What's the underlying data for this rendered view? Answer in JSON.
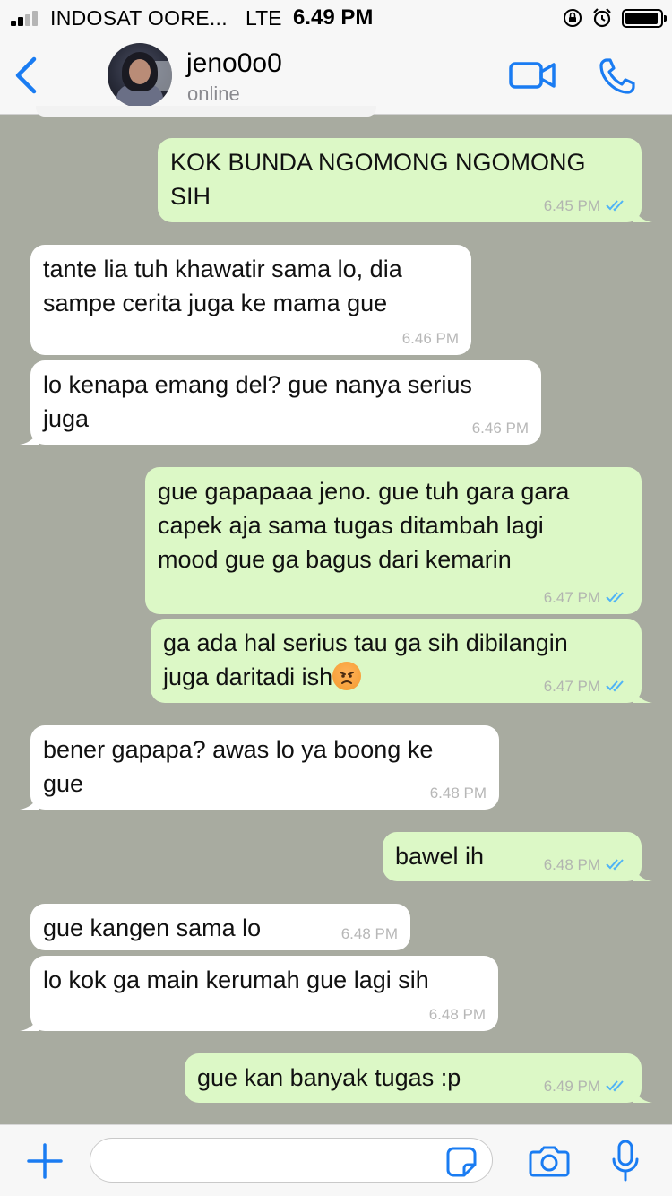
{
  "status_bar": {
    "carrier": "INDOSAT OORE...",
    "network": "LTE",
    "time": "6.49 PM"
  },
  "header": {
    "back_icon": "chevron-left-icon",
    "contact_name": "jeno0o0",
    "contact_status": "online",
    "video_icon": "video-camera-icon",
    "call_icon": "phone-icon"
  },
  "colors": {
    "accent": "#1a7cf2",
    "chat_background": "#a8aba0",
    "incoming_bubble": "#ffffff",
    "outgoing_bubble": "#dcf8c6",
    "read_ticks": "#4fb3f6"
  },
  "messages": [
    {
      "direction": "out",
      "text": "KOK BUNDA NGOMONG NGOMONG\nSIH",
      "time": "6.45 PM",
      "ticks": "read"
    },
    {
      "direction": "in",
      "text": "tante lia tuh khawatir sama lo, dia\nsampe cerita juga ke mama gue",
      "time": "6.46 PM"
    },
    {
      "direction": "in",
      "text": "lo kenapa emang del? gue nanya serius\njuga",
      "time": "6.46 PM"
    },
    {
      "direction": "out",
      "text": "gue gapapaaa jeno. gue tuh gara gara\ncapek aja sama tugas ditambah lagi\nmood gue ga bagus dari kemarin",
      "time": "6.47 PM",
      "ticks": "read"
    },
    {
      "direction": "out",
      "text": "ga ada hal serius tau ga sih dibilangin\njuga daritadi ish",
      "emoji": "angry-face-emoji",
      "time": "6.47 PM",
      "ticks": "read"
    },
    {
      "direction": "in",
      "text": "bener gapapa? awas lo ya boong ke\ngue",
      "time": "6.48 PM"
    },
    {
      "direction": "out",
      "text": "bawel ih",
      "time": "6.48 PM",
      "ticks": "read"
    },
    {
      "direction": "in",
      "text": "gue kangen sama lo",
      "time": "6.48 PM"
    },
    {
      "direction": "in",
      "text": "lo kok ga main kerumah gue lagi sih",
      "time": "6.48 PM"
    },
    {
      "direction": "out",
      "text": "gue kan banyak tugas :p",
      "time": "6.49 PM",
      "ticks": "read"
    }
  ],
  "input_bar": {
    "plus_icon": "plus-icon",
    "placeholder": "",
    "sticker_icon": "sticker-icon",
    "camera_icon": "camera-icon",
    "mic_icon": "microphone-icon"
  }
}
